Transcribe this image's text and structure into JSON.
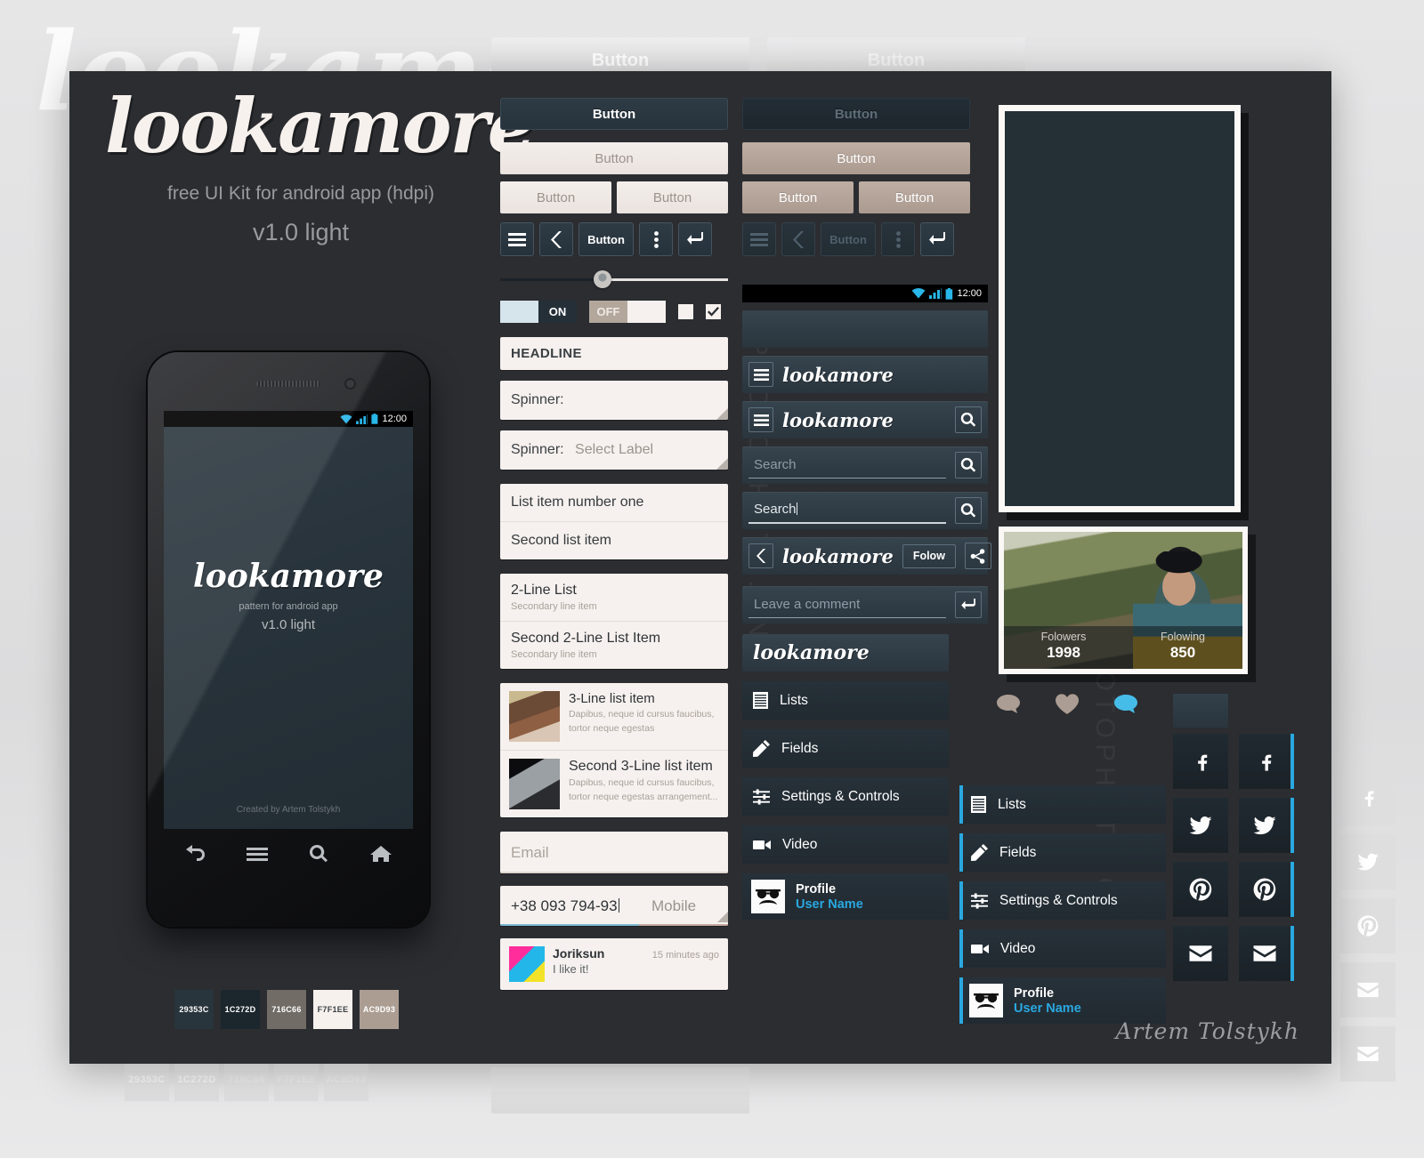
{
  "brand": {
    "name": "lookamore",
    "tagline": "free UI Kit for android app (hdpi)",
    "version": "v1.0 light",
    "signature": "Artem Tolstykh"
  },
  "phone": {
    "status_time": "12:00",
    "splash_logo": "lookamore",
    "splash_line1": "pattern for android app",
    "splash_line2": "v1.0 light",
    "credit": "Created by Artem Tolstykh",
    "nav": [
      "back-icon",
      "menu-icon",
      "search-icon",
      "home-icon"
    ]
  },
  "swatches": [
    {
      "hex": "29353C",
      "label": "29353C",
      "text": "#ffffff"
    },
    {
      "hex": "1C272D",
      "label": "1C272D",
      "text": "#ffffff"
    },
    {
      "hex": "716C66",
      "label": "716C66",
      "text": "#ffffff"
    },
    {
      "hex": "F7F1EE",
      "label": "F7F1EE",
      "text": "#3a3f43"
    },
    {
      "hex": "AC9D93",
      "label": "AC9D93",
      "text": "#ffffff"
    }
  ],
  "buttons": {
    "label": "Button",
    "normal_label": "Button",
    "pressed_label": "Button",
    "light_label": "Button",
    "tan_label": "Button",
    "pair_left": "Button",
    "pair_right": "Button",
    "iconbar_label": "Button"
  },
  "controls": {
    "toggle_on": "ON",
    "toggle_off": "OFF",
    "slider_value": 45
  },
  "forms": {
    "headline": "HEADLINE",
    "spinner_label": "Spinner:",
    "spinner_label2": "Spinner:",
    "spinner_value": "Select Label",
    "email_placeholder": "Email",
    "phone_value": "+38 093 794-93",
    "phone_type": "Mobile"
  },
  "lists": {
    "one_line": [
      "List item number one",
      "Second list item"
    ],
    "two_line": [
      {
        "title": "2-Line List",
        "subtitle": "Secondary line item"
      },
      {
        "title": "Second 2-Line List Item",
        "subtitle": "Secondary line item"
      }
    ],
    "three_line": [
      {
        "title": "3-Line list item",
        "line1": "Dapibus, neque id cursus faucibus,",
        "line2": "tortor neque egestas",
        "thumb": "portrait-thumb"
      },
      {
        "title": "Second 3-Line list item",
        "line1": "Dapibus, neque id cursus faucibus,",
        "line2": "tortor neque egestas arrangement...",
        "thumb": "car-thumb"
      }
    ]
  },
  "comment": {
    "author": "Joriksun",
    "time": "15 minutes ago",
    "body": "I like it!"
  },
  "actionbars": {
    "status_time": "12:00",
    "brand": "lookamore",
    "search_placeholder": "Search",
    "search_typed": "Search",
    "follow_label": "Folow",
    "comment_placeholder": "Leave a comment",
    "brand_tab": "lookamore"
  },
  "menu": {
    "items": [
      {
        "label": "Lists",
        "icon": "lists-icon"
      },
      {
        "label": "Fields",
        "icon": "pencil-icon"
      },
      {
        "label": "Settings & Controls",
        "icon": "sliders-icon"
      },
      {
        "label": "Video",
        "icon": "video-icon"
      }
    ],
    "profile": {
      "title": "Profile",
      "username": "User Name",
      "icon": "hipster-avatar-icon"
    }
  },
  "photocard": {
    "followers_label": "Folowers",
    "followers_value": "1998",
    "following_label": "Folowing",
    "following_value": "850"
  },
  "reactions": [
    {
      "name": "comment-bubble-icon",
      "color": "#ab9d93"
    },
    {
      "name": "heart-icon",
      "color": "#ab9d93"
    },
    {
      "name": "comment-bubble-icon",
      "color": "#46bde8"
    },
    {
      "name": "heart-icon",
      "color": "#f0626c"
    }
  ],
  "social": [
    {
      "name": "facebook-icon",
      "selected": false
    },
    {
      "name": "facebook-icon",
      "selected": true
    },
    {
      "name": "twitter-icon",
      "selected": false
    },
    {
      "name": "twitter-icon",
      "selected": true
    },
    {
      "name": "pinterest-icon",
      "selected": false
    },
    {
      "name": "pinterest-icon",
      "selected": true
    },
    {
      "name": "email-icon",
      "selected": false
    },
    {
      "name": "email-icon",
      "selected": true
    }
  ],
  "colors": {
    "accent": "#2aa8e0",
    "panel_bg": "#2b2d31",
    "dark_blue": "#29353C",
    "darker_blue": "#1C272D",
    "warm_gray": "#716C66",
    "cream": "#F7F1EE",
    "tan": "#AC9D93"
  }
}
